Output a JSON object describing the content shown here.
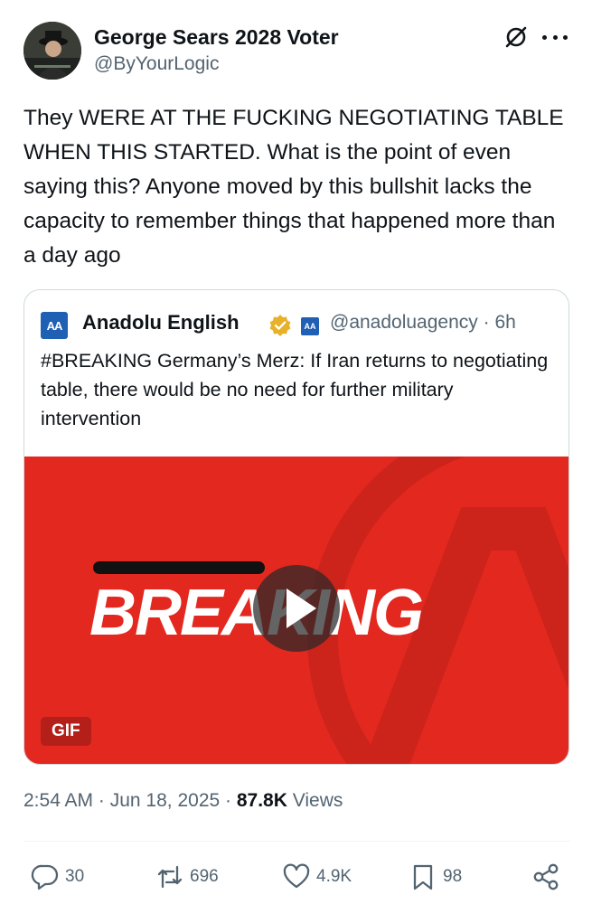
{
  "post": {
    "author_name": "George Sears 2028 Voter",
    "author_handle": "@ByYourLogic",
    "text": "They WERE AT THE FUCKING NEGOTIATING TABLE WHEN THIS STARTED. What is the point of even saying this? Anyone moved by this bullshit lacks the capacity to remember things that happened more than a day ago",
    "time": "2:54 AM",
    "date": "Jun 18, 2025",
    "views_count": "87.8K",
    "views_label": "Views"
  },
  "quote": {
    "logo_text": "AA",
    "author_name": "Anadolu English",
    "handle_time": "@anadoluagency · 6h",
    "text": "#BREAKING Germany’s Merz: If Iran returns to negotiating table, there would be no need for further military intervention",
    "media_text": "BREAKING",
    "media_badge": "GIF"
  },
  "actions": {
    "replies": "30",
    "reposts": "696",
    "likes": "4.9K",
    "bookmarks": "98"
  },
  "colors": {
    "accent_red": "#e2281f",
    "secondary_text": "#536471",
    "verified_gold": "#e8b12a",
    "agency_blue": "#1f5fb4"
  },
  "icons": [
    "grok-icon",
    "more-icon",
    "verified-badge-icon",
    "play-icon",
    "reply-icon",
    "repost-icon",
    "like-icon",
    "bookmark-icon",
    "share-icon"
  ]
}
